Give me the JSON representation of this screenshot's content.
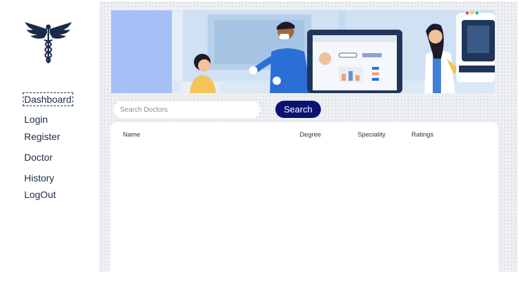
{
  "sidebar": {
    "logo_icon": "caduceus-icon",
    "items": [
      {
        "label": "Dashboard",
        "selected": true
      },
      {
        "label": "Login"
      },
      {
        "label": "Register"
      },
      {
        "label": "Doctor"
      },
      {
        "label": "History"
      },
      {
        "label": "LogOut"
      }
    ]
  },
  "banner": {
    "icon": "doctors-illustration"
  },
  "search": {
    "placeholder": "Search Doctors",
    "button_label": "Search"
  },
  "table": {
    "columns": [
      "Name",
      "Degree",
      "Speciality",
      "Ratings"
    ],
    "rows": []
  },
  "colors": {
    "accent": "#0c1272",
    "nav_text": "#1b2a4a",
    "panel_bg": "#eef0f3"
  }
}
